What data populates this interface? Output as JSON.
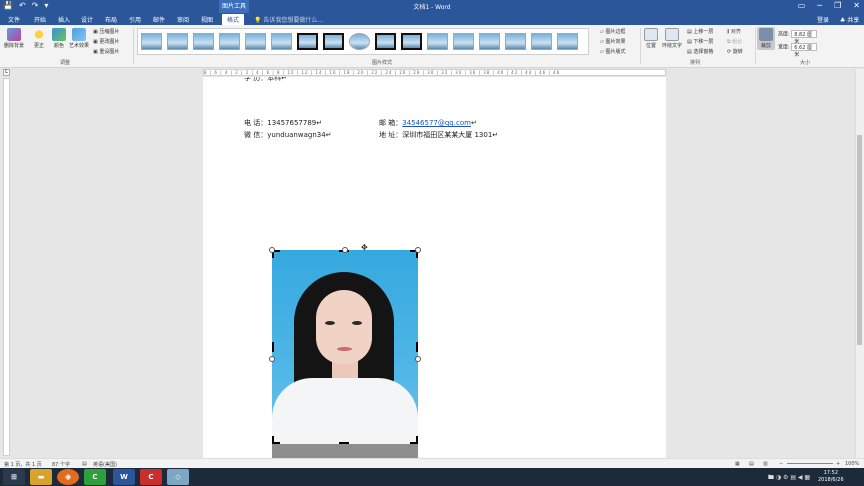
{
  "titlebar": {
    "document_title": "文档1 - Word",
    "contextual_tab": "图片工具",
    "qat": [
      "💾",
      "↶",
      "↷",
      "▾"
    ],
    "window_buttons": [
      "▭",
      "─",
      "❐",
      "✕"
    ]
  },
  "tabs": [
    "文件",
    "开始",
    "插入",
    "设计",
    "布局",
    "引用",
    "邮件",
    "审阅",
    "视图",
    "格式"
  ],
  "active_tab": "格式",
  "tell_me": "告诉我您想要做什么...",
  "login": "登录",
  "share": "♣ 共享",
  "ribbon": {
    "adjust": {
      "label": "调整",
      "remove_bg": "删除背景",
      "corrections": "更正",
      "color": "颜色",
      "artistic": "艺术效果",
      "compress": "压缩图片",
      "change": "更改图片",
      "reset": "重设图片"
    },
    "styles": {
      "label": "图片样式",
      "border": "图片边框",
      "effects": "图片效果",
      "layout": "图片版式"
    },
    "arrange": {
      "label": "排列",
      "position": "位置",
      "wrap": "环绕文字",
      "forward": "上移一层",
      "backward": "下移一层",
      "selection": "选择窗格",
      "align": "对齐",
      "group": "组合",
      "rotate": "旋转"
    },
    "size": {
      "label": "大小",
      "crop": "裁剪",
      "height_label": "高度:",
      "height_value": "8.82 厘米",
      "width_label": "宽度:",
      "width_value": "6.62 厘米"
    }
  },
  "ruler_text": "8 | 6 | 4 | 2 | 2 | 4 | 6 | 8 | 10 | 12 | 14 | 16 | 18 | 20 | 22 | 24 | 26 | 28 | 30 | 32 | 34 | 36 | 38 | 40 | 42 | 44 | 46 | 48",
  "document": {
    "line_cut": "学  历：本科↵",
    "phone_label": "电  话：",
    "phone_value": "13457657789↵",
    "email_label": "邮  箱：",
    "email_value": "34546577@qq.com",
    "email_tail": "↵",
    "wechat_label": "微  信：",
    "wechat_value": "yunduanwagn34↵",
    "address_label": "地  址：",
    "address_value": "深圳市福田区某某大厦 1301↵"
  },
  "statusbar": {
    "pages": "第 1 页，共 1 页",
    "words": "87 个字",
    "language": "英语(美国)",
    "zoom_minus": "−",
    "zoom_plus": "+",
    "zoom": "100%"
  },
  "taskbar": {
    "time": "17:52",
    "date": "2018/6/26",
    "tray": "🖿 ◑ ⚙ ▤ ◀ ▦"
  }
}
